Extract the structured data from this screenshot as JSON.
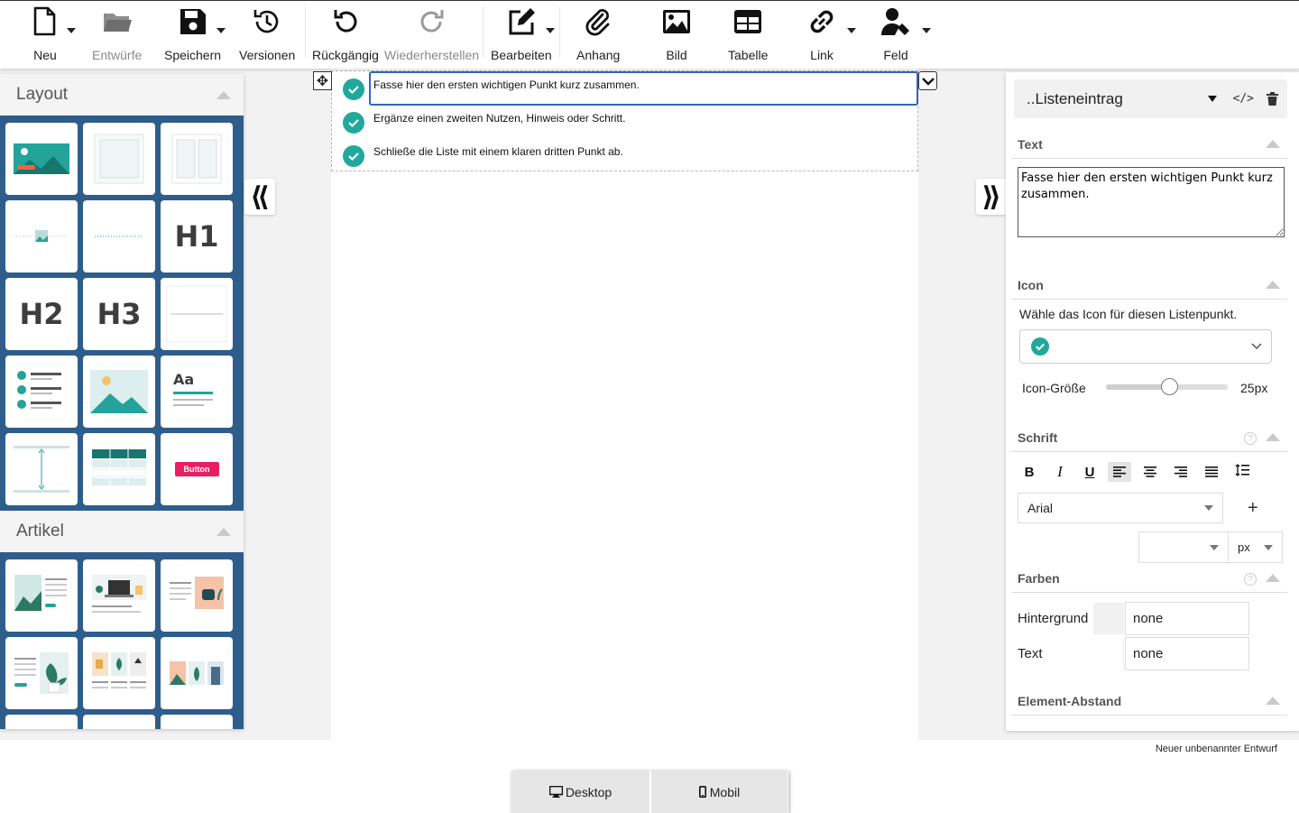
{
  "toolbar": {
    "new": "Neu",
    "drafts": "Entwürfe",
    "save": "Speichern",
    "versions": "Versionen",
    "undo": "Rückgängig",
    "redo": "Wiederherstellen",
    "edit": "Bearbeiten",
    "attachment": "Anhang",
    "image": "Bild",
    "table": "Tabelle",
    "link": "Link",
    "field": "Feld"
  },
  "left_panel": {
    "layout_title": "Layout",
    "layout_tiles": [
      "image-banner",
      "container-box",
      "two-column",
      "image-divider",
      "line-divider",
      "H1",
      "H2",
      "H3",
      "separator",
      "checklist",
      "image",
      "text-block",
      "spacer",
      "data-table",
      "Button"
    ],
    "articles_title": "Artikel"
  },
  "canvas": {
    "list_items": [
      "Fasse hier den ersten wichtigen Punkt kurz zusammen.",
      "Ergänze einen zweiten Nutzen, Hinweis oder Schritt.",
      "Schließe die Liste mit einem klaren dritten Punkt ab."
    ]
  },
  "right_panel": {
    "element_title": "..Listeneintrag",
    "text_section": "Text",
    "text_value": "Fasse hier den ersten wichtigen Punkt kurz zusammen.",
    "icon_section": "Icon",
    "icon_hint": "Wähle das Icon für diesen Listenpunkt.",
    "icon_size_label": "Icon-Größe",
    "icon_size_value": "25px",
    "icon_size_fraction": 0.52,
    "font_section": "Schrift",
    "font_family": "Arial",
    "font_size": "",
    "font_unit": "px",
    "colors_section": "Farben",
    "background_label": "Hintergrund",
    "background_value": "none",
    "text_color_label": "Text",
    "text_color_value": "none",
    "spacing_section": "Element-Abstand"
  },
  "footer": {
    "doc_name": "Neuer unbenannter Entwurf",
    "desktop": "Desktop",
    "mobile": "Mobil"
  },
  "colors": {
    "accent": "#21a89c",
    "selection": "#2f67b8",
    "panel_blue": "#2e5d8c",
    "button_pink": "#e8205f"
  }
}
